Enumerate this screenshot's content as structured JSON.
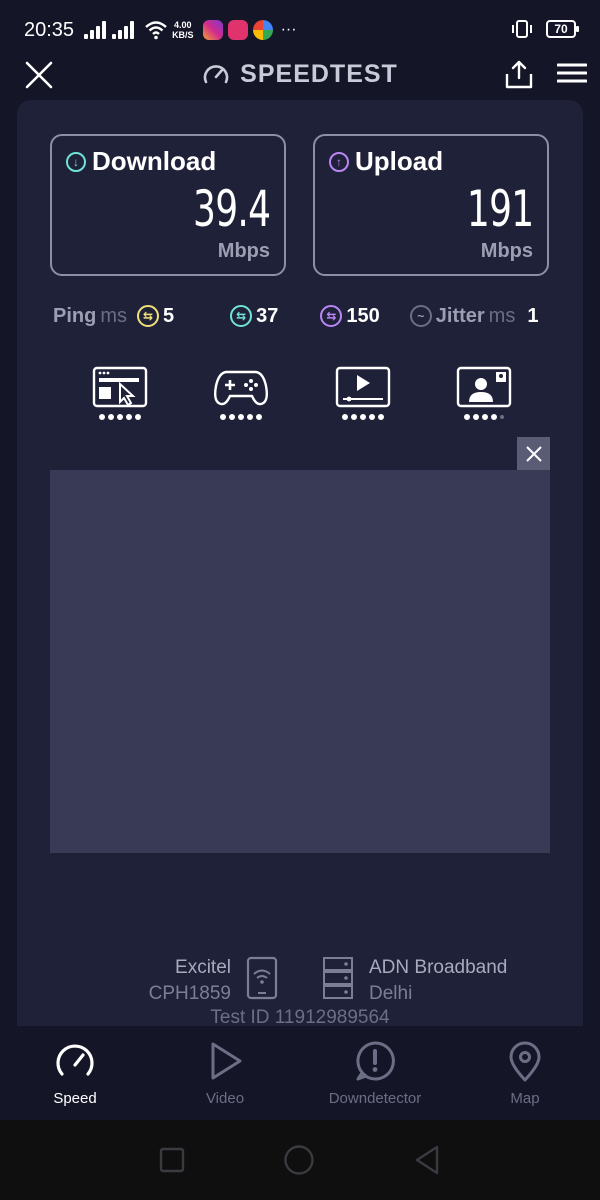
{
  "status_bar": {
    "time": "20:35",
    "net_speed_value": "4.00",
    "net_speed_unit": "KB/S",
    "more": "···",
    "battery": "70"
  },
  "header": {
    "title": "SPEEDTEST"
  },
  "download": {
    "label": "Download",
    "value": "39.4",
    "unit": "Mbps",
    "color": "#6fe3d8"
  },
  "upload": {
    "label": "Upload",
    "value": "191",
    "unit": "Mbps",
    "color": "#b986f5"
  },
  "metrics": {
    "ping_label": "Ping",
    "ping_unit": "ms",
    "idle_ping": "5",
    "download_ping": "37",
    "upload_ping": "150",
    "jitter_label": "Jitter",
    "jitter_unit": "ms",
    "jitter": "1",
    "idle_color": "#f1e07a",
    "download_color": "#6fe3d8",
    "upload_color": "#b986f5"
  },
  "apps": [
    {
      "icon": "web-browsing-icon",
      "rating": 5
    },
    {
      "icon": "gaming-icon",
      "rating": 5
    },
    {
      "icon": "video-streaming-icon",
      "rating": 5
    },
    {
      "icon": "video-call-icon",
      "rating": 4
    }
  ],
  "server": {
    "isp_name": "Excitel",
    "device": "CPH1859",
    "host_name": "ADN Broadband",
    "host_city": "Delhi",
    "test_id": "Test ID 11912989564"
  },
  "bottom_nav": [
    {
      "label": "Speed",
      "icon": "speedometer-icon",
      "active": true
    },
    {
      "label": "Video",
      "icon": "play-icon",
      "active": false
    },
    {
      "label": "Downdetector",
      "icon": "alert-icon",
      "active": false
    },
    {
      "label": "Map",
      "icon": "map-pin-icon",
      "active": false
    }
  ]
}
